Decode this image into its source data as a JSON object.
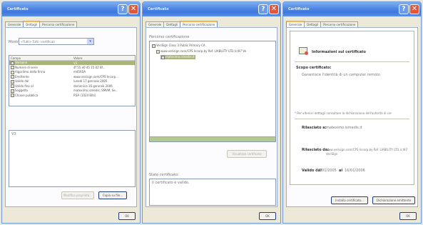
{
  "window1": {
    "title": "Certificato",
    "tabs": [
      "Generale",
      "Dettagli",
      "Percorso certificazione"
    ],
    "show_label": "Mostra:",
    "show_value": "<Tutti> Tutti i certificati",
    "columns": [
      "Campo",
      "Valore"
    ],
    "fields": [
      {
        "campo": "Versione",
        "valore": "V3"
      },
      {
        "campo": "Numero di serie",
        "valore": "4f 55 e0 d5 15 02 8f..."
      },
      {
        "campo": "Algoritmo della firma",
        "valore": "md5RSA"
      },
      {
        "campo": "Emittente",
        "valore": "www.verisign.com/CPS Incorp..."
      },
      {
        "campo": "Valido dal",
        "valore": "lunedì 17 gennaio 2005"
      },
      {
        "campo": "Valido fino al",
        "valore": "domenica 16 gennaio 2006"
      },
      {
        "campo": "Soggetto",
        "valore": "mateximo.ismedis, SMVM, Se..."
      },
      {
        "campo": "Chiave pubblica",
        "valore": "RSA (1024 Bits)"
      }
    ],
    "detail_value": "V3",
    "btn_modify": "Modifica proprietà...",
    "btn_copy": "Copia su file...",
    "btn_ok": "OK"
  },
  "window2": {
    "title": "Certificato",
    "tabs": [
      "Generale",
      "Dettagli",
      "Percorso certificazione"
    ],
    "path_label": "Percorso certificazione",
    "path_items": [
      "VeriSign Class 3 Public Primary CA",
      "www.verisign.com/CPS Incorp.by Ref. LIABILITY LTD.(c)97 Ve",
      "mateximo.ismedis.it"
    ],
    "btn_view": "Visualizza certificato",
    "status_label": "Stato certificato:",
    "status_value": "Il certificato è valido.",
    "btn_ok": "OK"
  },
  "window3": {
    "title": "Certificato",
    "tabs": [
      "Generale",
      "Dettagli",
      "Percorso certificazione"
    ],
    "info_title": "Informazioni sul certificato",
    "purpose_heading": "Scopo certificato:",
    "purpose_item": "Garantisce l'identità di un computer remoto",
    "note": "* Per ulteriori dettagli consultare la dichiarazione dell'autorità di cer",
    "issued_to_label": "Rilasciato a:",
    "issued_to_value": "mateximo.ismedis.it",
    "issued_by_label": "Rilasciato da:",
    "issued_by_value": "www.verisign.com/CPS Incorp.by Ref. LIABILITY LTD.(c)97 VeriSign",
    "valid_label": "Valido dal",
    "valid_from": "17/01/2005",
    "valid_to_label": "al",
    "valid_to": "16/01/2006",
    "btn_install": "Installa certificato...",
    "btn_statement": "Dichiarazione emittente",
    "btn_ok": "OK"
  }
}
